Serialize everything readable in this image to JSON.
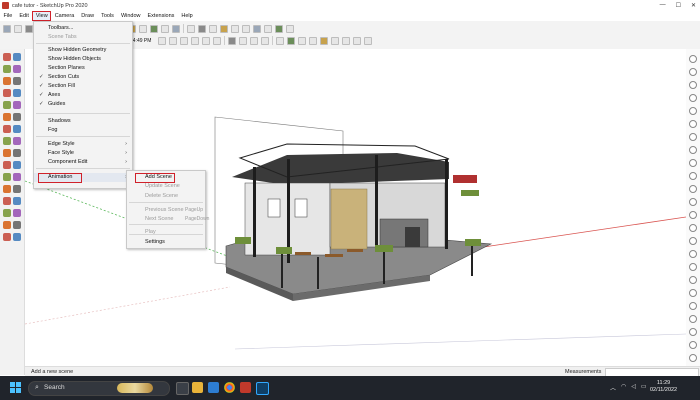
{
  "window": {
    "title": "cafe tutor - SketchUp Pro 2020",
    "minimize": "—",
    "maximize": "☐",
    "close": "✕"
  },
  "menu": [
    "File",
    "Edit",
    "View",
    "Camera",
    "Draw",
    "Tools",
    "Window",
    "Extensions",
    "Help"
  ],
  "toolbar_time": "14:49 PM",
  "view_menu": {
    "items": [
      {
        "label": "Toolbars...",
        "checked": false,
        "disabled": false,
        "submenu": false
      },
      {
        "label": "Scene Tabs",
        "checked": false,
        "disabled": true,
        "submenu": false
      },
      {
        "label": "Show Hidden Geometry",
        "checked": false,
        "disabled": false,
        "submenu": false
      },
      {
        "label": "Show Hidden Objects",
        "checked": false,
        "disabled": false,
        "submenu": false
      },
      {
        "label": "Section Planes",
        "checked": false,
        "disabled": false,
        "submenu": false
      },
      {
        "label": "Section Cuts",
        "checked": true,
        "disabled": false,
        "submenu": false
      },
      {
        "label": "Section Fill",
        "checked": true,
        "disabled": false,
        "submenu": false
      },
      {
        "label": "Axes",
        "checked": true,
        "disabled": false,
        "submenu": false
      },
      {
        "label": "Guides",
        "checked": true,
        "disabled": false,
        "submenu": false
      },
      {
        "label": "Shadows",
        "checked": false,
        "disabled": false,
        "submenu": false
      },
      {
        "label": "Fog",
        "checked": false,
        "disabled": false,
        "submenu": false
      },
      {
        "label": "Edge Style",
        "checked": false,
        "disabled": false,
        "submenu": true
      },
      {
        "label": "Face Style",
        "checked": false,
        "disabled": false,
        "submenu": true
      },
      {
        "label": "Component Edit",
        "checked": false,
        "disabled": false,
        "submenu": true
      },
      {
        "label": "Animation",
        "checked": false,
        "disabled": false,
        "submenu": true
      }
    ],
    "check_glyph": "✓",
    "arrow_glyph": "›"
  },
  "animation_submenu": {
    "items": [
      {
        "label": "Add Scene",
        "shortcut": "",
        "disabled": false
      },
      {
        "label": "Update Scene",
        "shortcut": "",
        "disabled": true
      },
      {
        "label": "Delete Scene",
        "shortcut": "",
        "disabled": true
      },
      {
        "label": "Previous Scene",
        "shortcut": "PageUp",
        "disabled": true
      },
      {
        "label": "Next Scene",
        "shortcut": "PageDown",
        "disabled": true
      },
      {
        "label": "Play",
        "shortcut": "",
        "disabled": true
      },
      {
        "label": "Settings",
        "shortcut": "",
        "disabled": false
      }
    ]
  },
  "status": {
    "message": "Add a new scene",
    "measurements_label": "Measurements"
  },
  "taskbar": {
    "search_label": "Search",
    "time": "11:29",
    "date": "02/11/2022"
  },
  "colors": {
    "highlight": "#d0212a",
    "axis_red": "#d9534f",
    "axis_green": "#5cb85c",
    "axis_blue": "#4a6fd1",
    "taskbar": "#20242b"
  }
}
